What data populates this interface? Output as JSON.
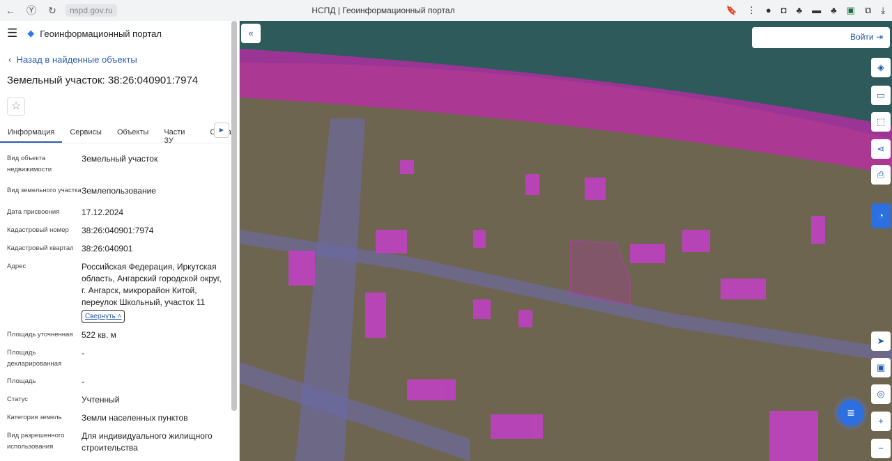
{
  "browser": {
    "url": "nspd.gov.ru",
    "title": "НСПД | Геоинформационный портал"
  },
  "header": {
    "app_title": "Геоинформационный портал"
  },
  "back_link": "Назад в найденные объекты",
  "object_title": "Земельный участок: 38:26:040901:7974",
  "tabs": [
    {
      "label": "Информация"
    },
    {
      "label": "Сервисы"
    },
    {
      "label": "Объекты"
    },
    {
      "label": "Части ЗУ"
    },
    {
      "label": "Соста"
    }
  ],
  "fields": [
    {
      "label": "Вид объекта недвижимости",
      "value": "Земельный участок"
    },
    {
      "label": "Вид земельного участка",
      "value": "Землепользование"
    },
    {
      "label": "Дата присвоения",
      "value": "17.12.2024"
    },
    {
      "label": "Кадастровый номер",
      "value": "38:26:040901:7974"
    },
    {
      "label": "Кадастровый квартал",
      "value": "38:26:040901"
    },
    {
      "label": "Адрес",
      "value": "Российская Федерация, Иркутская область, Ангарский городской округ, г. Ангарск, микрорайон Китой, переулок Школьный, участок 11"
    },
    {
      "label": "Площадь уточненная",
      "value": "522 кв. м"
    },
    {
      "label": "Площадь декларированная",
      "value": "-"
    },
    {
      "label": "Площадь",
      "value": "-"
    },
    {
      "label": "Статус",
      "value": "Учтенный"
    },
    {
      "label": "Категория земель",
      "value": "Земли населенных пунктов"
    },
    {
      "label": "Вид разрешенного использования",
      "value": "Для индивидуального жилищного строительства"
    }
  ],
  "collapse_label": "Свернуть",
  "map": {
    "login_label": "Войти"
  }
}
